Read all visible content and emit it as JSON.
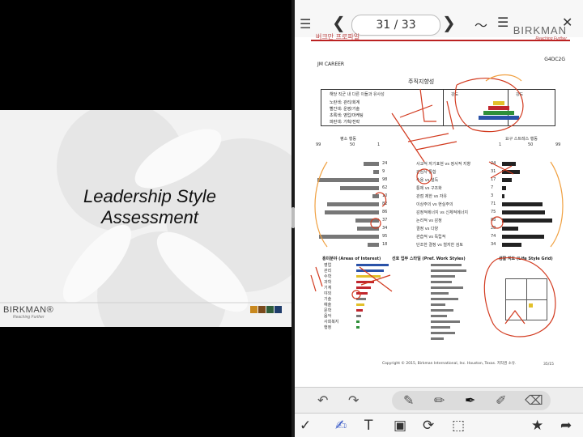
{
  "slide": {
    "title_line1": "Leadership Style",
    "title_line2": "Assessment",
    "brand": "BIRKMAN",
    "brand_tagline": "Reaching Further",
    "swatch_colors": [
      "#c8881e",
      "#7a4a1c",
      "#2e5d3a",
      "#1f3c6b"
    ]
  },
  "viewer": {
    "page_indicator": "31 / 33",
    "back_icon": "back-icon",
    "prev_icon": "chevron-left-icon",
    "next_icon": "chevron-right-icon"
  },
  "document": {
    "header_korean": "버크만 프로파일",
    "brand": "BIRKMAN",
    "brand_tagline": "Reaching Further",
    "career_label": "JM CAREER",
    "code": "G4DC2G",
    "section_title": "주직지향성",
    "table1_head_left": "해당 직군 내 다른 이들과 유사성",
    "table1_head_mid": "강도",
    "table1_head_right": "강도",
    "table1_rows": [
      "노란색: 관리/회계",
      "빨간색: 운영/기술",
      "초록색: 영업/마케팅",
      "파란색: 기획/전략"
    ],
    "scale_left": [
      "99",
      "50",
      "1"
    ],
    "scale_right": [
      "1",
      "50",
      "99"
    ],
    "legend_left": "평소 행동",
    "legend_right": "요구 스트레스 행동",
    "bars": [
      {
        "n": "24",
        "label": "사교적 자기표현 vs 정서적 지향"
      },
      {
        "n": "9",
        "label": "관심사 통합"
      },
      {
        "n": "98",
        "label": "수용 vs 설득"
      },
      {
        "n": "62",
        "label": "통제 vs 구조화"
      },
      {
        "n": "10",
        "label": "관점 제한 vs 자유"
      },
      {
        "n": "82",
        "label": "이상주의 vs 현실주의"
      },
      {
        "n": "86",
        "label": "감정적에너지 vs 신체적에너지"
      },
      {
        "n": "37",
        "label": "논리적 vs 감정"
      },
      {
        "n": "34",
        "label": "결정 vs 다양"
      },
      {
        "n": "95",
        "label": "관습적 vs 독립적"
      },
      {
        "n": "18",
        "label": "단조한 결정 vs 철저한 검토"
      }
    ],
    "right_numbers": [
      "24",
      "31",
      "17",
      "7",
      "3",
      "71",
      "75",
      "88",
      "28",
      "74",
      "34"
    ],
    "interest_title": "흥미분야 (Areas of Interest)",
    "work_style_title": "선호 업무 스타일 (Pref. Work Styles)",
    "life_grid_title": "생활 지도 (Life Style Grid)",
    "interests": [
      "영업",
      "관리",
      "수학",
      "과학",
      "기계",
      "야외",
      "기술",
      "예술",
      "문학",
      "음악",
      "사회복지",
      "행정"
    ],
    "copyright": "Copyright © 2015, Birkman International, Inc. Houston, Texas. 저작권 소유.",
    "page_number": "35/15"
  },
  "toolbar": {
    "undo_icon": "undo-icon",
    "redo_icon": "redo-icon",
    "pens": [
      "pen-icon",
      "marker-icon",
      "fountain-pen-icon",
      "highlighter-icon",
      "eraser-icon"
    ],
    "bottom_tools": [
      "done-icon",
      "draw-icon",
      "text-icon",
      "image-icon",
      "rotate-icon",
      "select-icon",
      "favorite-icon",
      "share-icon"
    ]
  }
}
